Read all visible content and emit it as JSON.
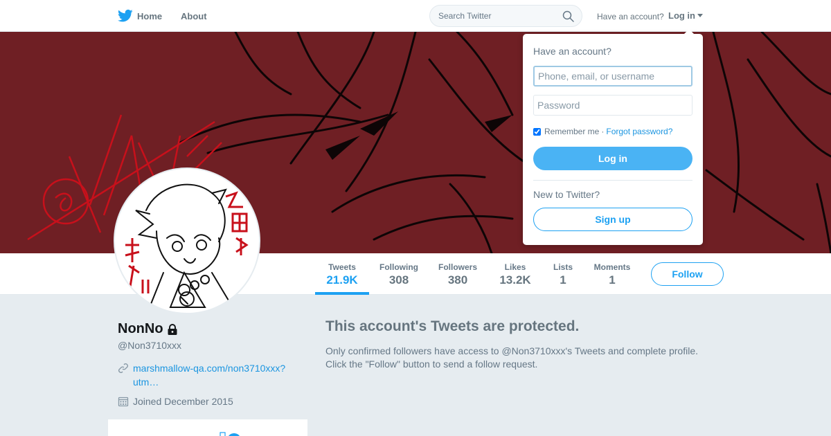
{
  "nav": {
    "home_label": "Home",
    "about_label": "About",
    "search_placeholder": "Search Twitter",
    "have_account": "Have an account?",
    "login_label": "Log in"
  },
  "colors": {
    "accent": "#1da1f2",
    "banner": "#6f1f24"
  },
  "profile_nav": {
    "stats": [
      {
        "label": "Tweets",
        "value": "21.9K"
      },
      {
        "label": "Following",
        "value": "308"
      },
      {
        "label": "Followers",
        "value": "380"
      },
      {
        "label": "Likes",
        "value": "13.2K"
      },
      {
        "label": "Lists",
        "value": "1"
      },
      {
        "label": "Moments",
        "value": "1"
      }
    ],
    "follow_label": "Follow"
  },
  "profile": {
    "name": "NonNo",
    "handle": "@Non3710xxx",
    "link_text": "marshmallow-qa.com/non3710xxx?utm…",
    "joined": "Joined December 2015"
  },
  "protected": {
    "title": "This account's Tweets are protected.",
    "body": "Only confirmed followers have access to @Non3710xxx's Tweets and complete profile. Click the \"Follow\" button to send a follow request."
  },
  "login_dropdown": {
    "title": "Have an account?",
    "username_placeholder": "Phone, email, or username",
    "password_placeholder": "Password",
    "remember_label": "Remember me",
    "separator": "·",
    "forgot_label": "Forgot password?",
    "login_button": "Log in",
    "new_label": "New to Twitter?",
    "signup_button": "Sign up"
  }
}
